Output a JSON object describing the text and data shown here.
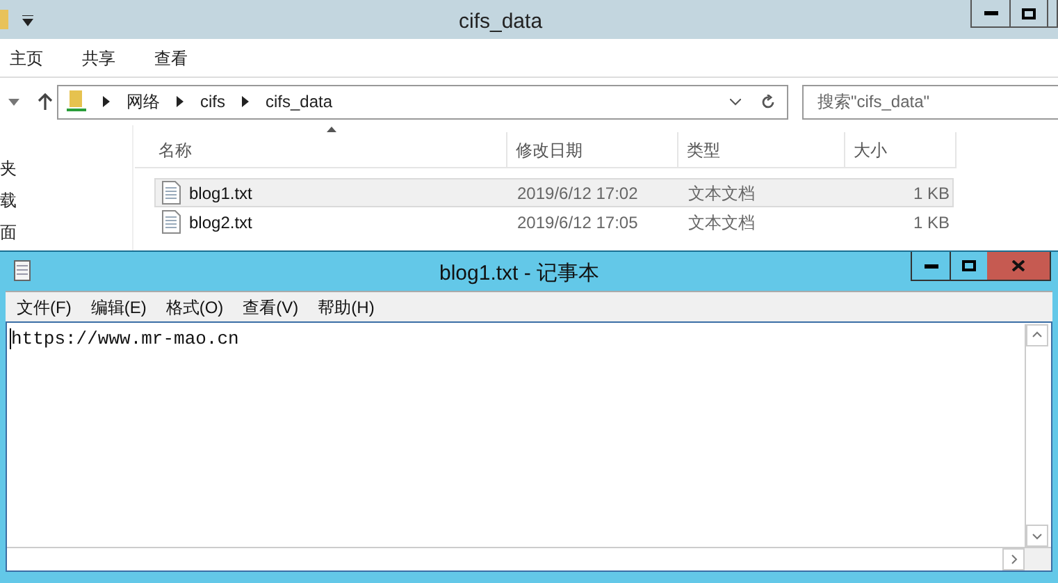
{
  "explorer": {
    "title": "cifs_data",
    "ribbon_tabs": [
      "主页",
      "共享",
      "查看"
    ],
    "breadcrumb": [
      "网络",
      "cifs",
      "cifs_data"
    ],
    "search": {
      "placeholder": "搜索\"cifs_data\""
    },
    "nav_items": [
      "夹",
      "载",
      "面"
    ],
    "columns": [
      "名称",
      "修改日期",
      "类型",
      "大小"
    ],
    "files": [
      {
        "name": "blog1.txt",
        "modified": "2019/6/12 17:02",
        "type": "文本文档",
        "size": "1 KB",
        "selected": true
      },
      {
        "name": "blog2.txt",
        "modified": "2019/6/12 17:05",
        "type": "文本文档",
        "size": "1 KB",
        "selected": false
      }
    ]
  },
  "notepad": {
    "title": "blog1.txt - 记事本",
    "menu": [
      "文件(F)",
      "编辑(E)",
      "格式(O)",
      "查看(V)",
      "帮助(H)"
    ],
    "content": "https://www.mr-mao.cn"
  }
}
